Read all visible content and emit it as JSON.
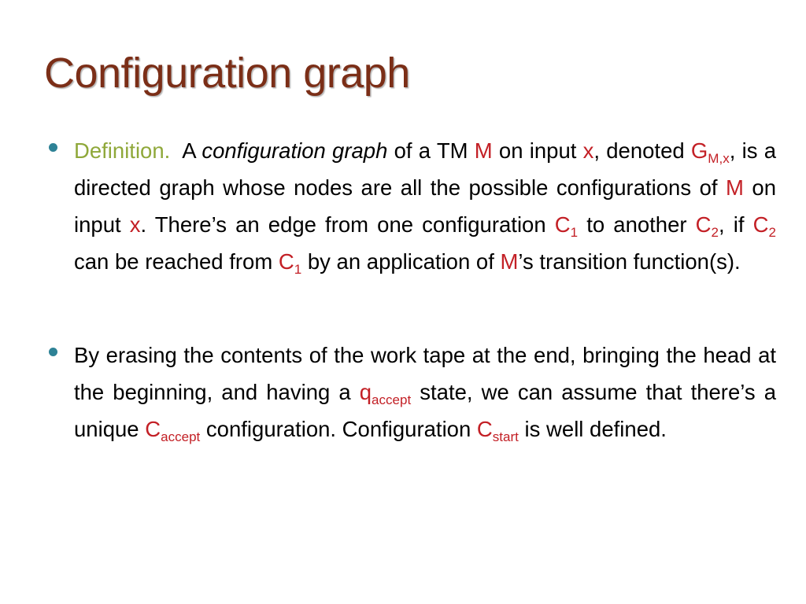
{
  "slide": {
    "title": "Configuration graph",
    "title_color": "#7b2e17",
    "accent_red": "#c32026",
    "accent_olive": "#8fa83a",
    "bullet_color": "#2e8296",
    "background": "#ffffff"
  },
  "bullets": [
    {
      "id": "definition-bullet",
      "lead_label": "Definition.",
      "segments": {
        "s1": "A ",
        "s2_italic": "configuration graph",
        "s3": " of a TM ",
        "s4_red": "M",
        "s5": " on input ",
        "s6_red": "x",
        "s7": ", denoted ",
        "s8_red_base": "G",
        "s8_red_sub": "M,x",
        "s9": ", is a directed graph whose nodes are all the possible configurations of ",
        "s10_red": "M",
        "s11": " on input ",
        "s12_red": "x",
        "s13": ". There’s an edge from one configuration ",
        "s14_red_base": "C",
        "s14_red_sub": "1",
        "s15": " to another ",
        "s16_red_base": "C",
        "s16_red_sub": "2",
        "s17": ", if ",
        "s18_red_base": "C",
        "s18_red_sub": "2",
        "s19": " can be reached from ",
        "s20_red_base": "C",
        "s20_red_sub": "1",
        "s21": " by an application of ",
        "s22_red": "M",
        "s23": "’s transition function(s)."
      },
      "plain_text": "Definition.  A configuration graph of a TM M on input x, denoted G_M,x, is a directed graph whose nodes are all the possible configurations of M on input x. There’s an edge from one configuration C_1 to another C_2, if C_2 can be reached from C_1 by an application of M’s transition function(s)."
    },
    {
      "id": "erasing-bullet",
      "lead_label": "",
      "segments": {
        "s1": "By erasing the contents of the work tape at the end, bringing the head at the beginning, and having a ",
        "s2_red_base": "q",
        "s2_red_sub": "accept",
        "s3": " state, we can assume that there’s a unique ",
        "s4_red_base": "C",
        "s4_red_sub": "accept",
        "s5": " configuration. Configuration ",
        "s6_red_base": "C",
        "s6_red_sub": "start",
        "s7": " is well defined."
      },
      "plain_text": "By erasing the contents of the work tape at the end, bringing the head at the beginning, and having a q_accept state, we can assume that there’s a unique C_accept configuration. Configuration C_start is well defined."
    }
  ]
}
